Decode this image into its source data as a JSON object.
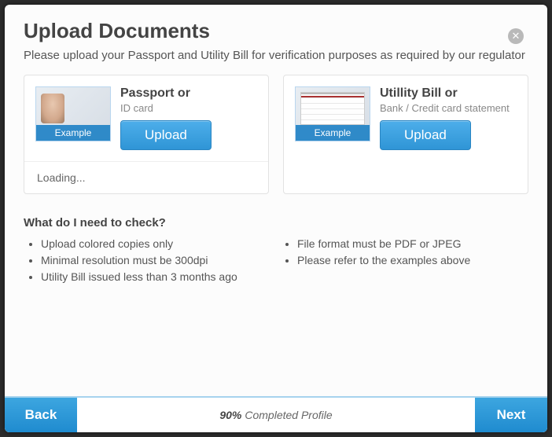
{
  "header": {
    "title": "Upload Documents",
    "subtitle": "Please upload your Passport and Utility Bill for verification purposes as required by our regulator",
    "close": "✕"
  },
  "cards": {
    "passport": {
      "title": "Passport or",
      "sub": "ID card",
      "button": "Upload",
      "example_label": "Example",
      "status": "Loading..."
    },
    "bill": {
      "title": "Utillity Bill or",
      "sub": "Bank / Credit card statement",
      "button": "Upload",
      "example_label": "Example"
    }
  },
  "checks": {
    "heading": "What do I need to check?",
    "left": [
      "Upload colored copies only",
      "Minimal resolution must be 300dpi",
      "Utility Bill issued less than 3 months ago"
    ],
    "right": [
      "File format must be PDF or JPEG",
      "Please refer to the examples above"
    ]
  },
  "footer": {
    "back": "Back",
    "next": "Next",
    "progress_pct": "90%",
    "progress_label": "Completed Profile"
  }
}
